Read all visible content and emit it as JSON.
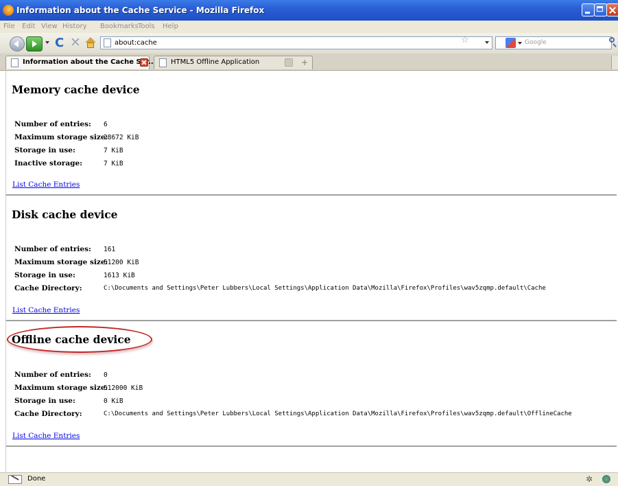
{
  "window": {
    "title": "Information about the Cache Service - Mozilla Firefox"
  },
  "menubar": {
    "items": [
      "File",
      "Edit",
      "View",
      "History",
      "Bookmarks",
      "Tools",
      "Help"
    ]
  },
  "navbar": {
    "url": "about:cache",
    "search_placeholder": "Google"
  },
  "tabs": [
    {
      "title": "Information about the Cache Ser...",
      "active": true
    },
    {
      "title": "HTML5 Offline Application",
      "active": false
    }
  ],
  "sections": [
    {
      "heading": "Memory cache device",
      "rows": [
        {
          "label": "Number of entries:",
          "value": "6"
        },
        {
          "label": "Maximum storage size:",
          "value": "28672 KiB"
        },
        {
          "label": "Storage in use:",
          "value": "7 KiB"
        },
        {
          "label": "Inactive storage:",
          "value": "7 KiB"
        }
      ],
      "link": "List Cache Entries"
    },
    {
      "heading": "Disk cache device",
      "rows": [
        {
          "label": "Number of entries:",
          "value": "161"
        },
        {
          "label": "Maximum storage size:",
          "value": "51200 KiB"
        },
        {
          "label": "Storage in use:",
          "value": "1613 KiB"
        },
        {
          "label": "Cache Directory:",
          "value": "C:\\Documents and Settings\\Peter Lubbers\\Local Settings\\Application Data\\Mozilla\\Firefox\\Profiles\\wav5zqmp.default\\Cache"
        }
      ],
      "link": "List Cache Entries"
    },
    {
      "heading": "Offline cache device",
      "rows": [
        {
          "label": "Number of entries:",
          "value": "0"
        },
        {
          "label": "Maximum storage size:",
          "value": "512000 KiB"
        },
        {
          "label": "Storage in use:",
          "value": "0 KiB"
        },
        {
          "label": "Cache Directory:",
          "value": "C:\\Documents and Settings\\Peter Lubbers\\Local Settings\\Application Data\\Mozilla\\Firefox\\Profiles\\wav5zqmp.default\\OfflineCache"
        }
      ],
      "link": "List Cache Entries"
    }
  ],
  "statusbar": {
    "text": "Done"
  },
  "colors": {
    "titlebar": "#2a5fd6",
    "link": "#0000ee",
    "highlight_oval": "#c22626",
    "chrome": "#ece9d8"
  },
  "icons": [
    "firefox-icon",
    "back-icon",
    "forward-icon",
    "reload-icon",
    "stop-icon",
    "home-icon",
    "page-icon",
    "star-icon",
    "google-icon",
    "search-icon",
    "tab-close-icon",
    "new-tab-icon",
    "status-icon",
    "bug-icon",
    "globe-icon"
  ]
}
